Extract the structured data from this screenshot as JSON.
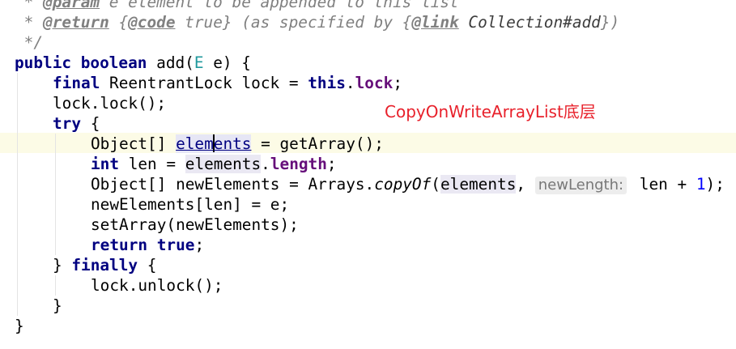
{
  "editor": {
    "annotation_note": "CopyOnWriteArrayList底层",
    "doc_comment": {
      "param_line": {
        "prefix": " * ",
        "tag": "@param",
        "text": " e element to be appended to this list"
      },
      "return_line": {
        "prefix": " * ",
        "tag": "@return",
        "open": " {",
        "code_tag": "@code",
        "code_text": " true} (as specified by {",
        "link_tag": "@link",
        "link_ref": " Collection#add",
        "close": "})"
      },
      "end_line": " */"
    },
    "code": {
      "signature": {
        "kw_public": "public",
        "kw_boolean": "boolean",
        "method": "add(",
        "type_param": "E",
        "params_rest": " e) {"
      },
      "lock_decl": {
        "kw_final": "final",
        "text1": " ReentrantLock lock = ",
        "kw_this": "this",
        "dot": ".",
        "field": "lock",
        "semi": ";"
      },
      "lock_call": "lock.lock();",
      "try_line": {
        "kw": "try",
        "brace": " {"
      },
      "elements_decl": {
        "text1": "Object[] ",
        "var_a": "elem",
        "var_b": "ents",
        "text2": " = getArray();"
      },
      "len_decl": {
        "kw_int": "int",
        "text1": " len = ",
        "var": "elements",
        "dot": ".",
        "field": "length",
        "semi": ";"
      },
      "copy_decl": {
        "text1": "Object[] newElements = Arrays.",
        "method": "copyOf",
        "paren": "(",
        "var": "elements",
        "comma": ", ",
        "hint": "newLength:",
        "text2": " len + ",
        "number": "1",
        "close": ");"
      },
      "assign_line": "newElements[len] = e;",
      "set_array_line": "setArray(newElements);",
      "return_line": {
        "kw_return": "return",
        "kw_true": "true",
        "semi": ";"
      },
      "finally_line": {
        "brace_open": "} ",
        "kw": "finally",
        "brace": " {"
      },
      "unlock_line": "lock.unlock();",
      "close_inner": "}",
      "close_outer": "}"
    }
  }
}
